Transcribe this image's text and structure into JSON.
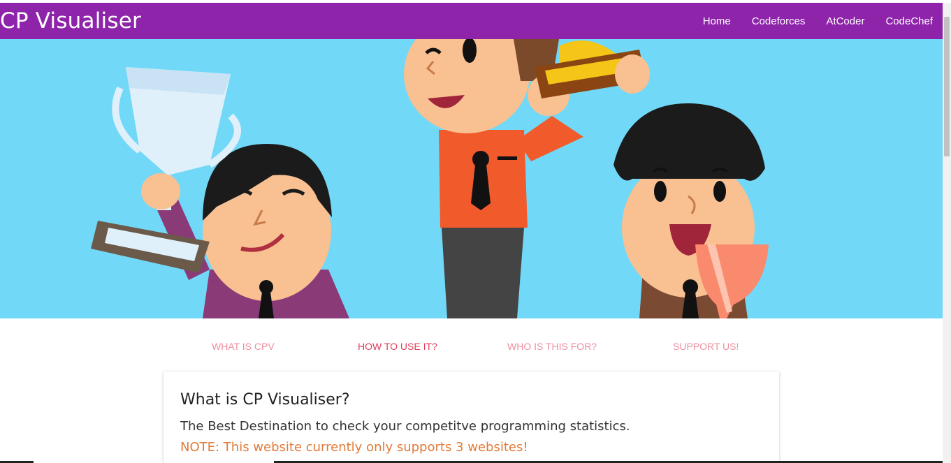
{
  "navbar": {
    "brand": "CP Visualiser",
    "links": [
      "Home",
      "Codeforces",
      "AtCoder",
      "CodeChef"
    ]
  },
  "hero": {
    "image": "trophy-winners-illustration",
    "background_color": "#72d8f7"
  },
  "tabs": {
    "items": [
      "WHAT IS CPV",
      "HOW TO USE IT?",
      "WHO IS THIS FOR?",
      "SUPPORT US!"
    ],
    "active_index": 1
  },
  "card": {
    "title": "What is CP Visualiser?",
    "text": "The Best Destination to check your competitve programming statistics.",
    "note": "NOTE: This website currently only supports 3 websites!"
  },
  "colors": {
    "navbar": "#8e24aa",
    "tab_text": "#ee8f9f",
    "tab_active": "#e0405e",
    "note": "#e07b39"
  }
}
